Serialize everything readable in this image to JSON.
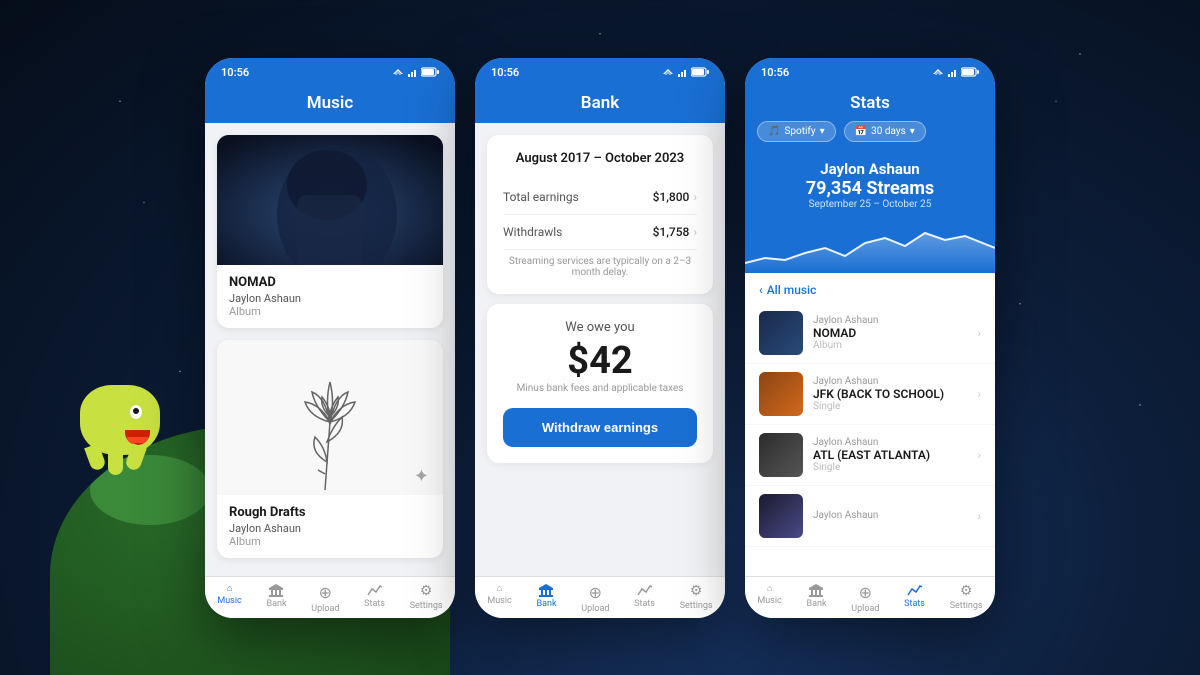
{
  "background": {
    "planet_color": "#1a4a1a",
    "mascot_color": "#c8e040"
  },
  "phone1": {
    "status_time": "10:56",
    "header_title": "Music",
    "albums": [
      {
        "title": "NOMAD",
        "artist": "Jaylon Ashaun",
        "type": "Album"
      },
      {
        "title": "Rough Drafts",
        "artist": "Jaylon Ashaun",
        "type": "Album"
      }
    ],
    "nav": [
      {
        "label": "Music",
        "active": true,
        "icon": "⌂"
      },
      {
        "label": "Bank",
        "active": false,
        "icon": "🏦"
      },
      {
        "label": "Upload",
        "active": false,
        "icon": "⊕"
      },
      {
        "label": "Stats",
        "active": false,
        "icon": "📈"
      },
      {
        "label": "Settings",
        "active": false,
        "icon": "⚙"
      }
    ]
  },
  "phone2": {
    "status_time": "10:56",
    "header_title": "Bank",
    "date_range": "August 2017 – October 2023",
    "rows": [
      {
        "label": "Total earnings",
        "value": "$1,800"
      },
      {
        "label": "Withdrawls",
        "value": "$1,758"
      }
    ],
    "streaming_note": "Streaming services are typically on a 2–3 month delay.",
    "owe_label": "We owe you",
    "owe_amount": "$42",
    "owe_note": "Minus bank fees and applicable taxes",
    "withdraw_btn": "Withdraw earnings",
    "nav": [
      {
        "label": "Music",
        "active": false,
        "icon": "⌂"
      },
      {
        "label": "Bank",
        "active": true,
        "icon": "🏦"
      },
      {
        "label": "Upload",
        "active": false,
        "icon": "⊕"
      },
      {
        "label": "Stats",
        "active": false,
        "icon": "📈"
      },
      {
        "label": "Settings",
        "active": false,
        "icon": "⚙"
      }
    ]
  },
  "phone3": {
    "status_time": "10:56",
    "header_title": "Stats",
    "filter_platform": "Spotify",
    "filter_period": "30 days",
    "artist_name": "Jaylon Ashaun",
    "streams": "79,354 Streams",
    "stats_date_range": "September 25 – October 25",
    "section_label": "All music",
    "music_items": [
      {
        "artist": "Jaylon Ashaun",
        "title": "NOMAD",
        "type": "Album",
        "thumb": "nomad"
      },
      {
        "artist": "Jaylon Ashaun",
        "title": "JFK (BACK TO SCHOOL)",
        "type": "Single",
        "thumb": "jfk"
      },
      {
        "artist": "Jaylon Ashaun",
        "title": "ATL (EAST ATLANTA)",
        "type": "Single",
        "thumb": "atl"
      },
      {
        "artist": "Jaylon Ashaun",
        "title": "",
        "type": "",
        "thumb": "last"
      }
    ],
    "nav": [
      {
        "label": "Music",
        "active": false,
        "icon": "⌂"
      },
      {
        "label": "Bank",
        "active": false,
        "icon": "🏦"
      },
      {
        "label": "Upload",
        "active": false,
        "icon": "⊕"
      },
      {
        "label": "Stats",
        "active": true,
        "icon": "📈"
      },
      {
        "label": "Settings",
        "active": false,
        "icon": "⚙"
      }
    ]
  }
}
